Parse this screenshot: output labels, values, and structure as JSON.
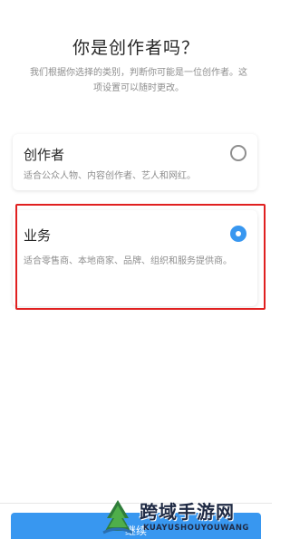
{
  "header": {
    "title": "你是创作者吗？",
    "subtitle": "我们根据你选择的类别，判断你可能是一位创作者。这项设置可以随时更改。"
  },
  "options": [
    {
      "title": "创作者",
      "description": "适合公众人物、内容创作者、艺人和网红。",
      "selected": false
    },
    {
      "title": "业务",
      "description": "适合零售商、本地商家、品牌、组织和服务提供商。",
      "selected": true
    }
  ],
  "footer": {
    "continue_label": "继续"
  },
  "watermark": {
    "text_cn": "跨域手游网",
    "text_en": "KUAYUSHOUYOUWANG"
  },
  "colors": {
    "accent": "#3897f0",
    "highlight": "#e02020",
    "text_primary": "#262626",
    "text_secondary": "#8e8e8e"
  }
}
